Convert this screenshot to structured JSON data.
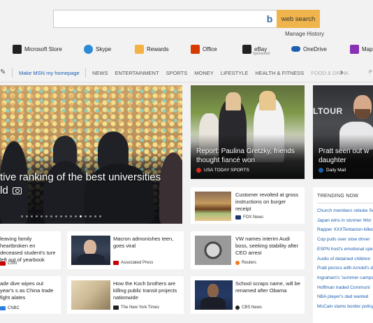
{
  "search": {
    "placeholder": "",
    "button_label": "web search",
    "manage_history": "Manage History"
  },
  "quicklinks": [
    {
      "label": "Microsoft Store",
      "icon": "store-icon",
      "color": "#222222"
    },
    {
      "label": "Skype",
      "icon": "skype-icon",
      "color": "#2d8ad8"
    },
    {
      "label": "Rewards",
      "icon": "rewards-icon",
      "color": "#f2b342"
    },
    {
      "label": "Office",
      "icon": "office-icon",
      "color": "#d83b01"
    },
    {
      "label": "eBay",
      "icon": "ebay-icon",
      "color": "#222222",
      "sub": "Sponsored"
    },
    {
      "label": "OneDrive",
      "icon": "onedrive-icon",
      "color": "#1b5fb0"
    },
    {
      "label": "Maps",
      "icon": "maps-icon",
      "color": "#8b2fb5"
    }
  ],
  "nav": {
    "home_link": "Make MSN my homepage",
    "links": [
      "NEWS",
      "ENTERTAINMENT",
      "SPORTS",
      "MONEY",
      "LIFESTYLE",
      "HEALTH & FITNESS",
      "FOOD & DRINK"
    ],
    "overflow_letter": "P"
  },
  "hero": {
    "title_line1": "tive ranking of the best universities",
    "title_line2": "ld",
    "dots": 17,
    "active_dot": 12
  },
  "card_mid": {
    "title": "Report: Paulina Gretzky, friends thought fiancé won",
    "source": "USA TODAY SPORTS",
    "source_color": "#d62d20"
  },
  "card_right": {
    "overlay_text": "LTOUR",
    "title": "Pratt seen out w daughter",
    "source": "Daily Mail",
    "source_color": "#1b5fb0"
  },
  "cards": [
    {
      "title": "Customer revolted at gross instructions on burger receipt",
      "source": "FOX News",
      "logo_color": "#1a3a6e"
    },
    {
      "title": "leaving family heartbroken en deceased student's ture left out of yearbook",
      "source": "CNN",
      "logo_color": "#cc0000"
    },
    {
      "title": "Macron admonishes teen, goes viral",
      "source": "Associated Press",
      "logo_color": "#cc0000"
    },
    {
      "title": "VW names interim Audi boss, seeking stability after CEO arrest",
      "source": "Reuters",
      "logo_color": "#f47920"
    },
    {
      "title": "ade dive wipes out year's s as China trade fight alates",
      "source": "CNBC",
      "logo_color": "#2a7de1"
    },
    {
      "title": "How the Koch brothers are killing public transit projects nationwide",
      "source": "The New York Times",
      "logo_color": "#222222"
    },
    {
      "title": "School scraps name, will be renamed after Obama",
      "source": "CBS News",
      "logo_color": "#222222"
    }
  ],
  "trending": {
    "heading": "TRENDING NOW",
    "items": [
      "Church members rebuke Se",
      "Japan wins in stunner  Wor",
      "Rapper XXXTentacion killed",
      "Cop pulls over slow driver",
      "ESPN host's emotional spee",
      "Audio of detained children",
      "Pratt picnics with Arnold's d",
      "Ingraham's 'summer camps'",
      "Hoffman traded  Communi",
      "NBA player's dad wanted",
      "McCain slams border policy"
    ]
  }
}
